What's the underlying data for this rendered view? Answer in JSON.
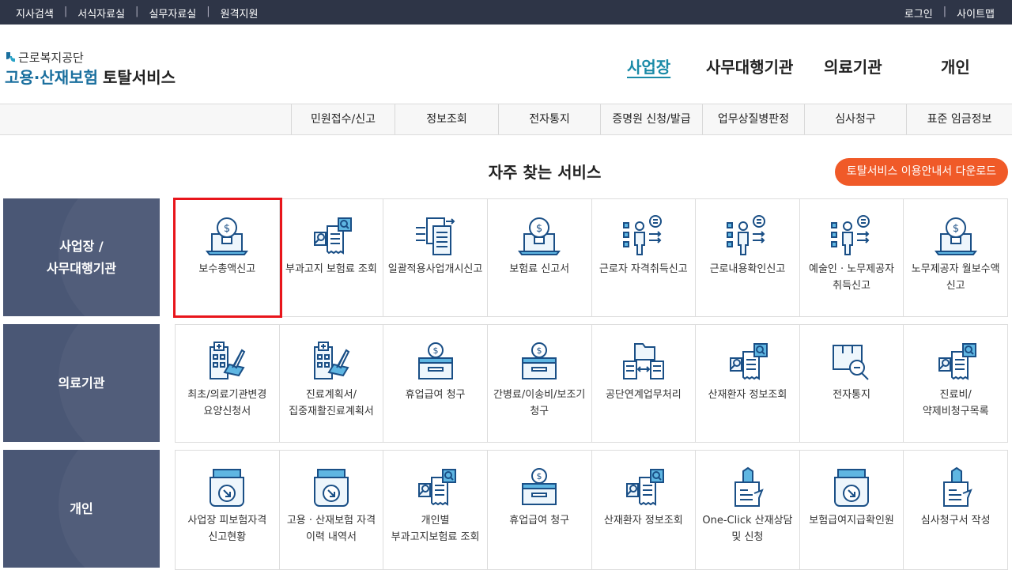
{
  "topbar": {
    "left_links": [
      "지사검색",
      "서식자료실",
      "실무자료실",
      "원격지원"
    ],
    "right_links": [
      "로그인",
      "사이트맵"
    ],
    "separator": "|"
  },
  "header": {
    "org_name": "근로복지공단",
    "title_part1": "고용·산재보험",
    "title_part2": "토탈서비스",
    "nav": [
      "사업장",
      "사무대행기관",
      "의료기관",
      "개인"
    ],
    "active_nav": "사업장"
  },
  "submenu": [
    "민원접수/신고",
    "정보조회",
    "전자통지",
    "증명원 신청/발급",
    "업무상질병판정",
    "심사청구",
    "표준 임금정보"
  ],
  "section": {
    "title": "자주 찾는 서비스",
    "download_button": "토탈서비스 이용안내서 다운로드"
  },
  "colors": {
    "topbar": "#2e3547",
    "category_bg": "#4a5775",
    "icon_blue": "#1a4f86",
    "accent": "#f05a28",
    "highlight": "#e8151b"
  },
  "rows": [
    {
      "category_lines": [
        "사업장 /",
        "사무대행기관"
      ],
      "items": [
        {
          "label": "보수총액신고",
          "icon": "money-bulb-laptop-icon"
        },
        {
          "label": "부과고지 보험료 조회",
          "icon": "document-search-icon"
        },
        {
          "label": "일괄적용사업개시신고",
          "icon": "documents-transfer-icon"
        },
        {
          "label": "보험료 신고서",
          "icon": "money-bulb-laptop-icon"
        },
        {
          "label": "근로자 자격취득신고",
          "icon": "person-checklist-icon"
        },
        {
          "label": "근로내용확인신고",
          "icon": "person-checklist-icon"
        },
        {
          "label": "예술인 · 노무제공자 취득신고",
          "icon": "person-checklist-icon"
        },
        {
          "label": "노무제공자 월보수액 신고",
          "icon": "money-bulb-laptop-icon"
        }
      ]
    },
    {
      "category_lines": [
        "의료기관"
      ],
      "items": [
        {
          "label": "최초/의료기관변경 요양신청서",
          "icon": "hospital-pen-icon"
        },
        {
          "label": "진료계획서/집중재활진료계획서",
          "icon": "hospital-pen-icon"
        },
        {
          "label": "휴업급여 청구",
          "icon": "money-box-icon"
        },
        {
          "label": "간병료/이송비/보조기 청구",
          "icon": "money-box-icon"
        },
        {
          "label": "공단연계업무처리",
          "icon": "folder-exchange-icon"
        },
        {
          "label": "산재환자 정보조회",
          "icon": "document-search-icon"
        },
        {
          "label": "전자통지",
          "icon": "box-search-icon"
        },
        {
          "label": "진료비/약제비청구목록",
          "icon": "document-search-icon"
        }
      ]
    },
    {
      "category_lines": [
        "개인"
      ],
      "items": [
        {
          "label": "사업장 피보험자격 신고현황",
          "icon": "tray-arrow-icon"
        },
        {
          "label": "고용 · 산재보험 자격 이력 내역서",
          "icon": "tray-arrow-icon"
        },
        {
          "label": "개인별 부과고지보험료 조회",
          "icon": "document-search-icon"
        },
        {
          "label": "휴업급여 청구",
          "icon": "money-box-icon"
        },
        {
          "label": "산재환자 정보조회",
          "icon": "document-search-icon"
        },
        {
          "label": "One-Click 산재상담 및 신청",
          "icon": "pen-document-icon"
        },
        {
          "label": "보험급여지급확인원",
          "icon": "tray-arrow-icon"
        },
        {
          "label": "심사청구서 작성",
          "icon": "pen-document-icon"
        }
      ]
    }
  ]
}
